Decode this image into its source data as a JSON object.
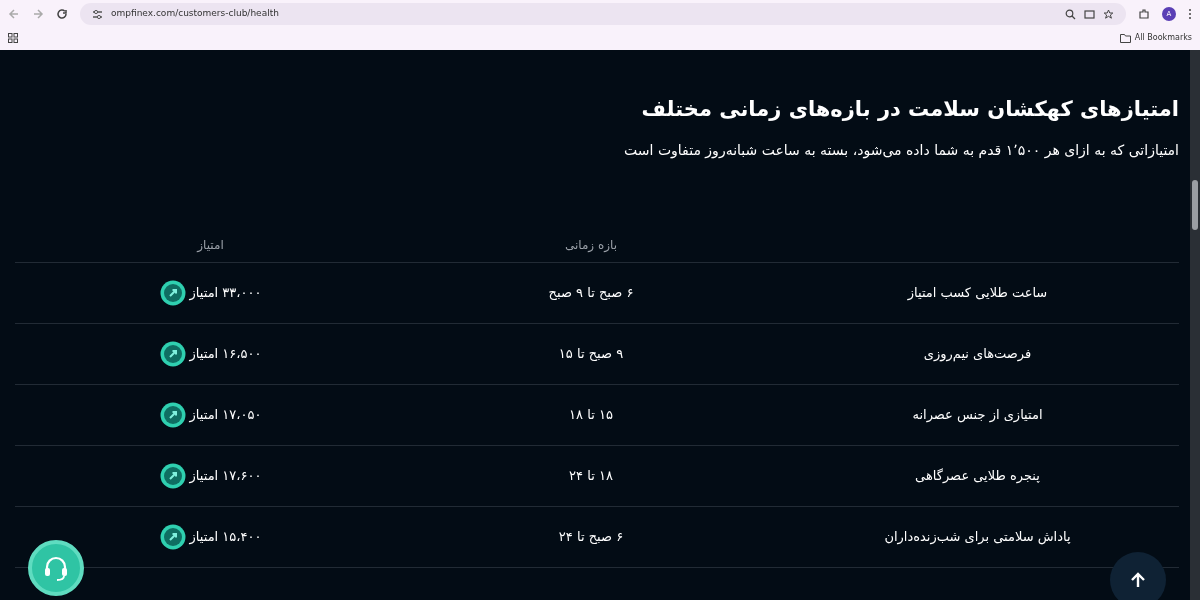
{
  "browser": {
    "url": "ompfinex.com/customers-club/health",
    "avatar": "A",
    "bookmarks": "All Bookmarks"
  },
  "heading": "امتیازهای کهکشان سلامت در بازه‌های زمانی مختلف",
  "subtitle": "امتیازاتی که به ازای هر ۱٬۵۰۰ قدم به شما داده می‌شود، بسته به ساعت شبانه‌روز متفاوت است",
  "table": {
    "columns": [
      "بازه زمانی",
      "امتیاز"
    ],
    "rows": [
      {
        "title": "ساعت طلایی کسب امتیاز",
        "period": "۶ صبح تا ۹ صبح",
        "points": "۳۳،۰۰۰ امتیاز"
      },
      {
        "title": "فرصت‌های نیم‌روزی",
        "period": "۹ صبح تا ۱۵",
        "points": "۱۶،۵۰۰ امتیاز"
      },
      {
        "title": "امتیازی از جنس عصرانه",
        "period": "۱۵ تا ۱۸",
        "points": "۱۷،۰۵۰ امتیاز"
      },
      {
        "title": "پنجره طلایی عصرگاهی",
        "period": "۱۸ تا ۲۴",
        "points": "۱۷،۶۰۰ امتیاز"
      },
      {
        "title": "پاداش سلامتی برای شب‌زنده‌داران",
        "period": "۶ صبح تا ۲۴",
        "points": "۱۵،۴۰۰ امتیاز"
      }
    ]
  }
}
